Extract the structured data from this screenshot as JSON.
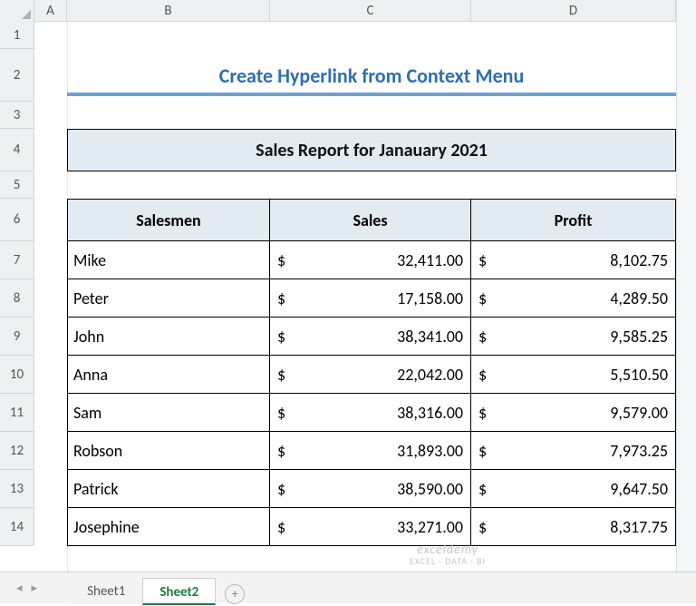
{
  "columns": {
    "A": "A",
    "B": "B",
    "C": "C",
    "D": "D"
  },
  "rows": [
    "1",
    "2",
    "3",
    "4",
    "5",
    "6",
    "7",
    "8",
    "9",
    "10",
    "11",
    "12",
    "13",
    "14"
  ],
  "title": "Create Hyperlink from Context Menu",
  "report_header": "Sales Report for Janauary 2021",
  "headers": {
    "salesmen": "Salesmen",
    "sales": "Sales",
    "profit": "Profit"
  },
  "currency": "$",
  "data": [
    {
      "name": "Mike",
      "sales": "32,411.00",
      "profit": "8,102.75"
    },
    {
      "name": "Peter",
      "sales": "17,158.00",
      "profit": "4,289.50"
    },
    {
      "name": "John",
      "sales": "38,341.00",
      "profit": "9,585.25"
    },
    {
      "name": "Anna",
      "sales": "22,042.00",
      "profit": "5,510.50"
    },
    {
      "name": "Sam",
      "sales": "38,316.00",
      "profit": "9,579.00"
    },
    {
      "name": "Robson",
      "sales": "31,893.00",
      "profit": "7,973.25"
    },
    {
      "name": "Patrick",
      "sales": "38,590.00",
      "profit": "9,647.50"
    },
    {
      "name": "Josephine",
      "sales": "33,271.00",
      "profit": "8,317.75"
    }
  ],
  "tabs": {
    "sheet1": "Sheet1",
    "sheet2": "Sheet2",
    "new": "+"
  },
  "nav": {
    "first": "◄",
    "prev": "◂",
    "next": "▸",
    "last": "►"
  },
  "watermark": {
    "line1": "exceldemy",
    "line2": "EXCEL · DATA · BI"
  }
}
